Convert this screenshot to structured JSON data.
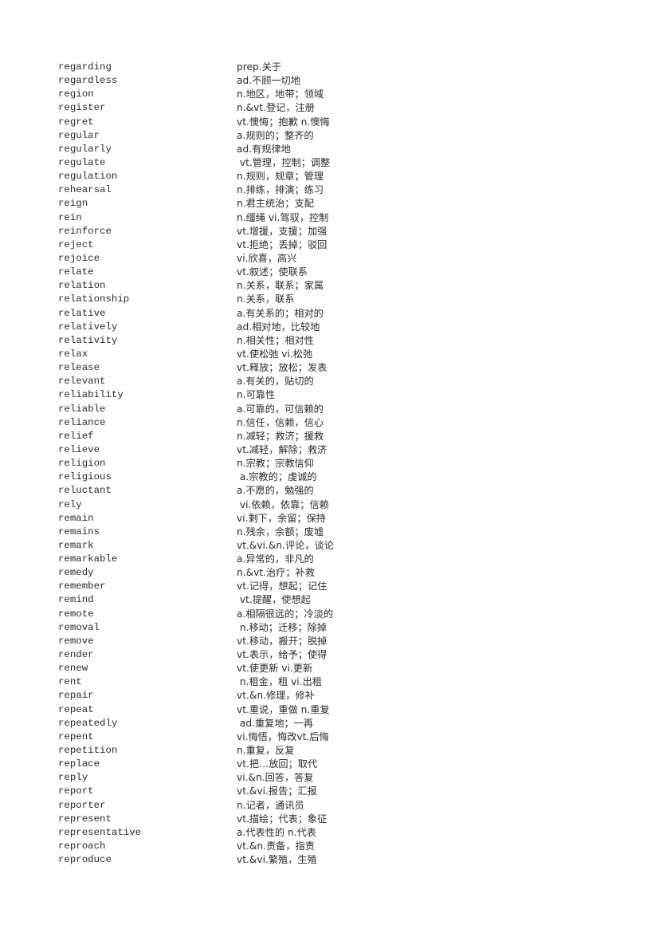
{
  "document": {
    "type": "vocabulary-word-list",
    "section_letter": "r",
    "entry_count": 59,
    "columns": {
      "term_header": "",
      "definition_header": ""
    },
    "entries": [
      {
        "term": "regarding",
        "definition": "prep.关于"
      },
      {
        "term": "regardless",
        "definition": "ad.不顾一切地"
      },
      {
        "term": "region",
        "definition": "n.地区，地带；领域"
      },
      {
        "term": "register",
        "definition": "n.&vt.登记，注册"
      },
      {
        "term": "regret",
        "definition": "vt.懊悔；抱歉 n.懊悔"
      },
      {
        "term": "regular",
        "definition": "a.规则的；整齐的"
      },
      {
        "term": "regularly",
        "definition": "ad.有规律地"
      },
      {
        "term": "regulate",
        "definition": " vt.管理，控制；调整"
      },
      {
        "term": "regulation",
        "definition": "n.规则，规章；管理"
      },
      {
        "term": "rehearsal",
        "definition": "n.排练，排演；练习"
      },
      {
        "term": "reign",
        "definition": "n.君主统治；支配"
      },
      {
        "term": "rein",
        "definition": "n.缰绳 vi.驾驭，控制"
      },
      {
        "term": "reinforce",
        "definition": "vt.增援，支援；加强"
      },
      {
        "term": "reject",
        "definition": "vt.拒绝；丢掉；驳回"
      },
      {
        "term": "rejoice",
        "definition": "vi.欣喜，高兴"
      },
      {
        "term": "relate",
        "definition": "vt.叙述；使联系"
      },
      {
        "term": "relation",
        "definition": "n.关系，联系；家属"
      },
      {
        "term": "relationship",
        "definition": "n.关系，联系"
      },
      {
        "term": "relative",
        "definition": "a.有关系的；相对的"
      },
      {
        "term": "relatively",
        "definition": "ad.相对地，比较地"
      },
      {
        "term": "relativity",
        "definition": "n.相关性；相对性"
      },
      {
        "term": "relax",
        "definition": "vt.使松弛 vi.松弛"
      },
      {
        "term": "release",
        "definition": "vt.释放；放松；发表"
      },
      {
        "term": "relevant",
        "definition": "a.有关的，贴切的"
      },
      {
        "term": "reliability",
        "definition": "n.可靠性"
      },
      {
        "term": "reliable",
        "definition": "a.可靠的，可信赖的"
      },
      {
        "term": "reliance",
        "definition": "n.信任，信赖，信心"
      },
      {
        "term": "relief",
        "definition": "n.减轻；救济；援救"
      },
      {
        "term": "relieve",
        "definition": "vt.减轻，解除；救济"
      },
      {
        "term": "religion",
        "definition": "n.宗教；宗教信仰"
      },
      {
        "term": "religious",
        "definition": " a.宗教的；虔诚的"
      },
      {
        "term": "reluctant",
        "definition": "a.不愿的，勉强的"
      },
      {
        "term": "rely",
        "definition": " vi.依赖，依靠；信赖"
      },
      {
        "term": "remain",
        "definition": "vi.剩下，余留；保持"
      },
      {
        "term": "remains",
        "definition": "n.残余，余额；废墟"
      },
      {
        "term": "remark",
        "definition": "vt.&vi.&n.评论，谈论"
      },
      {
        "term": "remarkable",
        "definition": "a.异常的，非凡的"
      },
      {
        "term": "remedy",
        "definition": "n.&vt.治疗；补救"
      },
      {
        "term": "remember",
        "definition": "vt.记得，想起；记住"
      },
      {
        "term": "remind",
        "definition": " vt.提醒，使想起"
      },
      {
        "term": "remote",
        "definition": "a.相隔很远的；冷淡的"
      },
      {
        "term": "removal",
        "definition": " n.移动；迁移；除掉"
      },
      {
        "term": "remove",
        "definition": "vt.移动，搬开；脱掉"
      },
      {
        "term": "render",
        "definition": "vt.表示，给予；使得"
      },
      {
        "term": "renew",
        "definition": "vt.使更新 vi.更新"
      },
      {
        "term": "rent",
        "definition": " n.租金，租 vi.出租"
      },
      {
        "term": "repair",
        "definition": "vt.&n.修理，修补"
      },
      {
        "term": "repeat",
        "definition": "vt.重说，重做 n.重复"
      },
      {
        "term": "repeatedly",
        "definition": " ad.重复地；一再"
      },
      {
        "term": "repent",
        "definition": "vi.悔悟，悔改vt.后悔"
      },
      {
        "term": "repetition",
        "definition": "n.重复，反复"
      },
      {
        "term": "replace",
        "definition": "vt.把…放回；取代"
      },
      {
        "term": "reply",
        "definition": "vi.&n.回答，答复"
      },
      {
        "term": "report",
        "definition": "vt.&vi.报告；汇报"
      },
      {
        "term": "reporter",
        "definition": "n.记者，通讯员"
      },
      {
        "term": "represent",
        "definition": "vt.描绘；代表；象征"
      },
      {
        "term": "representative",
        "definition": "a.代表性的 n.代表"
      },
      {
        "term": "reproach",
        "definition": "vt.&n.责备，指责"
      },
      {
        "term": "reproduce",
        "definition": "vt.&vi.繁殖，生殖"
      }
    ]
  },
  "colors": {
    "page_background": "#ffffff",
    "text": "#2b2b2b"
  }
}
